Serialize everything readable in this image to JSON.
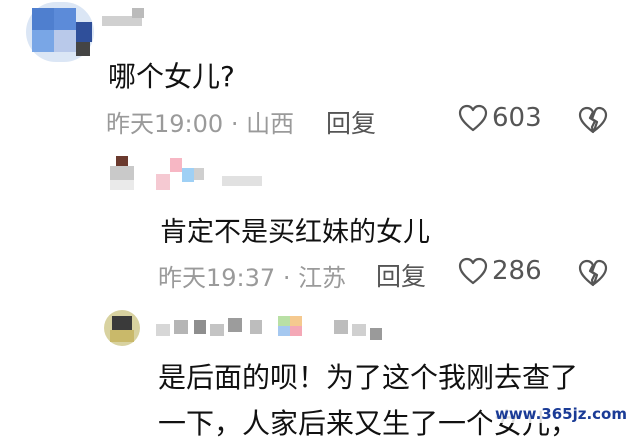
{
  "comments": [
    {
      "text": "哪个女儿?",
      "time": "昨天19:00",
      "sep": "·",
      "location": "山西",
      "reply_label": "回复",
      "likes": "603"
    },
    {
      "text": "肯定不是买红妹的女儿",
      "time": "昨天19:37",
      "sep": "·",
      "location": "江苏",
      "reply_label": "回复",
      "likes": "286"
    },
    {
      "text_line1": "是后面的呗！为了这个我刚去查了",
      "text_line2": "一下，人家后来又生了一个女儿，"
    }
  ],
  "watermark": "www.365jz.com",
  "icons": {
    "like": "heart-outline-icon",
    "dislike": "broken-heart-icon"
  }
}
